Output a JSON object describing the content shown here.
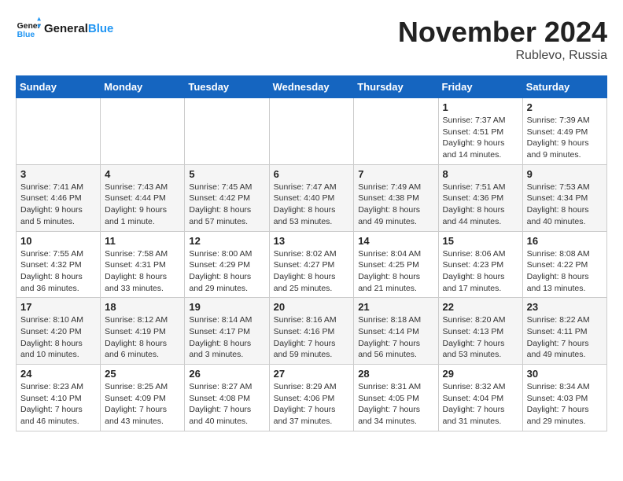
{
  "header": {
    "logo": "GeneralBlue",
    "month": "November 2024",
    "location": "Rublevo, Russia"
  },
  "days_of_week": [
    "Sunday",
    "Monday",
    "Tuesday",
    "Wednesday",
    "Thursday",
    "Friday",
    "Saturday"
  ],
  "weeks": [
    [
      {
        "day": "",
        "info": ""
      },
      {
        "day": "",
        "info": ""
      },
      {
        "day": "",
        "info": ""
      },
      {
        "day": "",
        "info": ""
      },
      {
        "day": "",
        "info": ""
      },
      {
        "day": "1",
        "info": "Sunrise: 7:37 AM\nSunset: 4:51 PM\nDaylight: 9 hours and 14 minutes."
      },
      {
        "day": "2",
        "info": "Sunrise: 7:39 AM\nSunset: 4:49 PM\nDaylight: 9 hours and 9 minutes."
      }
    ],
    [
      {
        "day": "3",
        "info": "Sunrise: 7:41 AM\nSunset: 4:46 PM\nDaylight: 9 hours and 5 minutes."
      },
      {
        "day": "4",
        "info": "Sunrise: 7:43 AM\nSunset: 4:44 PM\nDaylight: 9 hours and 1 minute."
      },
      {
        "day": "5",
        "info": "Sunrise: 7:45 AM\nSunset: 4:42 PM\nDaylight: 8 hours and 57 minutes."
      },
      {
        "day": "6",
        "info": "Sunrise: 7:47 AM\nSunset: 4:40 PM\nDaylight: 8 hours and 53 minutes."
      },
      {
        "day": "7",
        "info": "Sunrise: 7:49 AM\nSunset: 4:38 PM\nDaylight: 8 hours and 49 minutes."
      },
      {
        "day": "8",
        "info": "Sunrise: 7:51 AM\nSunset: 4:36 PM\nDaylight: 8 hours and 44 minutes."
      },
      {
        "day": "9",
        "info": "Sunrise: 7:53 AM\nSunset: 4:34 PM\nDaylight: 8 hours and 40 minutes."
      }
    ],
    [
      {
        "day": "10",
        "info": "Sunrise: 7:55 AM\nSunset: 4:32 PM\nDaylight: 8 hours and 36 minutes."
      },
      {
        "day": "11",
        "info": "Sunrise: 7:58 AM\nSunset: 4:31 PM\nDaylight: 8 hours and 33 minutes."
      },
      {
        "day": "12",
        "info": "Sunrise: 8:00 AM\nSunset: 4:29 PM\nDaylight: 8 hours and 29 minutes."
      },
      {
        "day": "13",
        "info": "Sunrise: 8:02 AM\nSunset: 4:27 PM\nDaylight: 8 hours and 25 minutes."
      },
      {
        "day": "14",
        "info": "Sunrise: 8:04 AM\nSunset: 4:25 PM\nDaylight: 8 hours and 21 minutes."
      },
      {
        "day": "15",
        "info": "Sunrise: 8:06 AM\nSunset: 4:23 PM\nDaylight: 8 hours and 17 minutes."
      },
      {
        "day": "16",
        "info": "Sunrise: 8:08 AM\nSunset: 4:22 PM\nDaylight: 8 hours and 13 minutes."
      }
    ],
    [
      {
        "day": "17",
        "info": "Sunrise: 8:10 AM\nSunset: 4:20 PM\nDaylight: 8 hours and 10 minutes."
      },
      {
        "day": "18",
        "info": "Sunrise: 8:12 AM\nSunset: 4:19 PM\nDaylight: 8 hours and 6 minutes."
      },
      {
        "day": "19",
        "info": "Sunrise: 8:14 AM\nSunset: 4:17 PM\nDaylight: 8 hours and 3 minutes."
      },
      {
        "day": "20",
        "info": "Sunrise: 8:16 AM\nSunset: 4:16 PM\nDaylight: 7 hours and 59 minutes."
      },
      {
        "day": "21",
        "info": "Sunrise: 8:18 AM\nSunset: 4:14 PM\nDaylight: 7 hours and 56 minutes."
      },
      {
        "day": "22",
        "info": "Sunrise: 8:20 AM\nSunset: 4:13 PM\nDaylight: 7 hours and 53 minutes."
      },
      {
        "day": "23",
        "info": "Sunrise: 8:22 AM\nSunset: 4:11 PM\nDaylight: 7 hours and 49 minutes."
      }
    ],
    [
      {
        "day": "24",
        "info": "Sunrise: 8:23 AM\nSunset: 4:10 PM\nDaylight: 7 hours and 46 minutes."
      },
      {
        "day": "25",
        "info": "Sunrise: 8:25 AM\nSunset: 4:09 PM\nDaylight: 7 hours and 43 minutes."
      },
      {
        "day": "26",
        "info": "Sunrise: 8:27 AM\nSunset: 4:08 PM\nDaylight: 7 hours and 40 minutes."
      },
      {
        "day": "27",
        "info": "Sunrise: 8:29 AM\nSunset: 4:06 PM\nDaylight: 7 hours and 37 minutes."
      },
      {
        "day": "28",
        "info": "Sunrise: 8:31 AM\nSunset: 4:05 PM\nDaylight: 7 hours and 34 minutes."
      },
      {
        "day": "29",
        "info": "Sunrise: 8:32 AM\nSunset: 4:04 PM\nDaylight: 7 hours and 31 minutes."
      },
      {
        "day": "30",
        "info": "Sunrise: 8:34 AM\nSunset: 4:03 PM\nDaylight: 7 hours and 29 minutes."
      }
    ]
  ]
}
